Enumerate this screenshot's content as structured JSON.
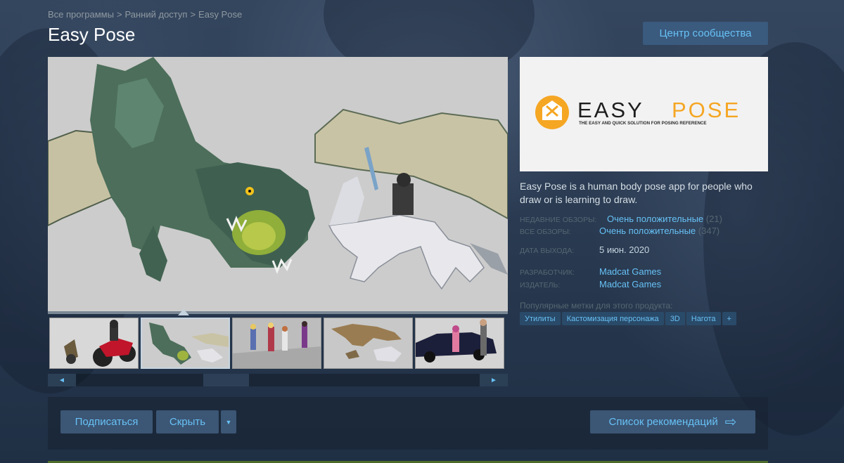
{
  "breadcrumb": [
    "Все программы",
    "Ранний доступ",
    "Easy Pose"
  ],
  "title": "Easy Pose",
  "community_button": "Центр сообщества",
  "capsule": {
    "brand_easy": "EASY",
    "brand_pose": "POSE",
    "tagline": "THE EASY AND QUICK SOLUTION FOR POSING REFERENCE"
  },
  "description": "Easy Pose is a human body pose app for people who draw or is learning to draw.",
  "reviews": {
    "recent_label": "НЕДАВНИЕ ОБЗОРЫ:",
    "recent_value": "Очень положительные",
    "recent_count": "(21)",
    "all_label": "ВСЕ ОБЗОРЫ:",
    "all_value": "Очень положительные",
    "all_count": "(347)"
  },
  "release": {
    "label": "ДАТА ВЫХОДА:",
    "value": "5 июн. 2020"
  },
  "developer": {
    "label": "РАЗРАБОТЧИК:",
    "value": "Madcat Games"
  },
  "publisher": {
    "label": "ИЗДАТЕЛЬ:",
    "value": "Madcat Games"
  },
  "tags_title": "Популярные метки для этого продукта:",
  "tags": [
    "Утилиты",
    "Кастомизация персонажа",
    "3D",
    "Нагота",
    "+"
  ],
  "thumbnails": [
    "motorcycle-scene",
    "dragon-scene",
    "group-poses-scene",
    "dinosaur-scene",
    "car-scene"
  ],
  "active_thumbnail": "dragon-scene",
  "scroll": {
    "left_arrow": "◄",
    "right_arrow": "►"
  },
  "actions": {
    "subscribe": "Подписаться",
    "hide": "Скрыть",
    "dropdown": "▼",
    "wishlist": "Список рекомендаций",
    "wishlist_icon": "⇨"
  },
  "colors": {
    "accent": "#67c1f5",
    "button_bg": "#3c5675",
    "background": "#1b2838",
    "logo_orange": "#f5a623"
  }
}
